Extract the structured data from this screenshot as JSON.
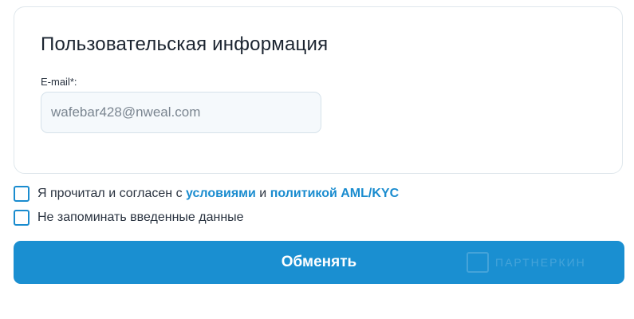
{
  "form": {
    "title": "Пользовательская информация",
    "email_label": "E-mail*:",
    "email_value": "wafebar428@nweal.com"
  },
  "agreement": {
    "text_before": "Я прочитал и согласен с ",
    "terms_link": "условиями",
    "text_middle": " и ",
    "aml_link": "политикой AML/KYC",
    "checked": false
  },
  "remember": {
    "text": "Не запоминать введенные данные",
    "checked": false
  },
  "submit": {
    "label": "Обменять"
  },
  "watermark": {
    "text": "ПАРТНЕРКИН"
  },
  "colors": {
    "accent": "#1a8fd1",
    "link": "#1a8ccf",
    "title": "#1b2430"
  }
}
